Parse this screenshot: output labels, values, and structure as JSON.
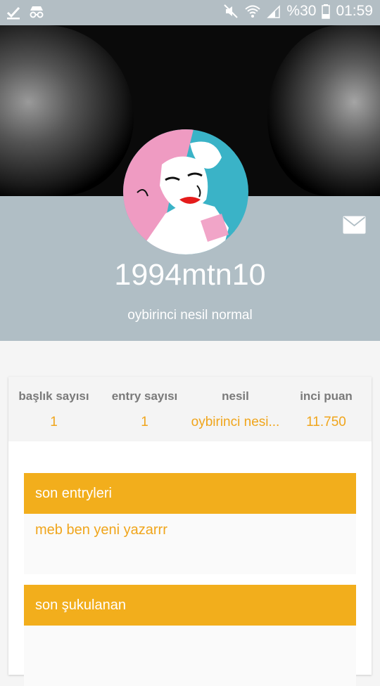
{
  "status_bar": {
    "battery": "%30",
    "time": "01:59",
    "icons": [
      "check-icon",
      "incognito-icon",
      "mute-icon",
      "wifi-icon",
      "signal-icon",
      "battery-icon"
    ]
  },
  "profile": {
    "username": "1994mtn10",
    "generation_label": "oybirinci nesil normal",
    "header_color": "#b0bec5",
    "accent": "#f2ae1c"
  },
  "stats": [
    {
      "label": "başlık sayısı",
      "value": "1"
    },
    {
      "label": "entry sayısı",
      "value": "1"
    },
    {
      "label": "nesil",
      "value": "oybirinci nesi..."
    },
    {
      "label": "inci puan",
      "value": "11.750"
    }
  ],
  "sections": {
    "recent_entries": {
      "title": "son entryleri",
      "items": [
        "meb ben yeni yazarrr"
      ]
    },
    "recent_sukulanan": {
      "title": "son şukulanan",
      "items": []
    }
  }
}
